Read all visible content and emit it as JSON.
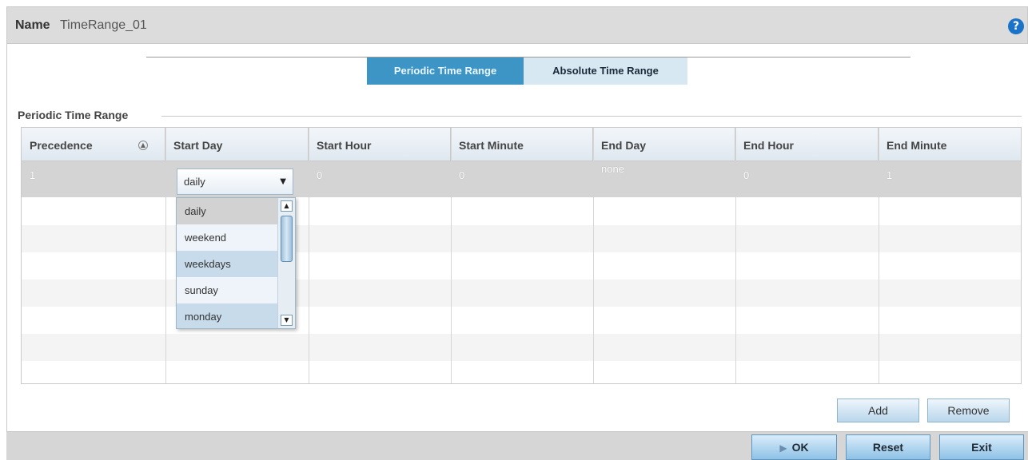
{
  "header": {
    "name_label": "Name",
    "name_value": "TimeRange_01",
    "help_icon": "?"
  },
  "tabs": [
    {
      "label": "Periodic Time Range",
      "selected": true
    },
    {
      "label": "Absolute Time Range",
      "selected": false
    }
  ],
  "section": {
    "label": "Periodic Time Range"
  },
  "table": {
    "columns": [
      "Precedence",
      "Start Day",
      "Start Hour",
      "Start Minute",
      "End Day",
      "End Hour",
      "End Minute"
    ],
    "rows": [
      {
        "precedence": "1",
        "start_day": "daily",
        "start_hour": "0",
        "start_minute": "0",
        "end_day": "none",
        "end_hour": "0",
        "end_minute": "1"
      }
    ]
  },
  "start_day_dropdown": {
    "selected": "daily",
    "options": [
      "daily",
      "weekend",
      "weekdays",
      "sunday",
      "monday"
    ]
  },
  "actions": {
    "add": "Add",
    "remove": "Remove"
  },
  "footer": {
    "ok": "OK",
    "reset": "Reset",
    "exit": "Exit"
  },
  "colors": {
    "tab_active_bg": "#3d95c6",
    "tab_inactive_bg": "#d7e8f2",
    "help_icon": "#1a73c9",
    "selected_row": "#d4d4d4"
  }
}
